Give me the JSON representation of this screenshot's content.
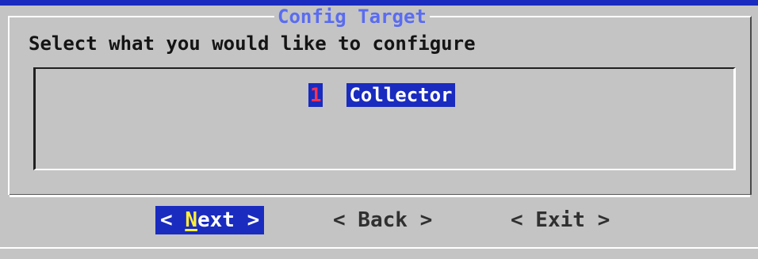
{
  "dialog": {
    "title": "Config Target",
    "prompt": "Select what you would like to configure"
  },
  "menu": {
    "items": [
      {
        "key": "1",
        "label": "Collector"
      }
    ]
  },
  "buttons": {
    "next": {
      "open": "< ",
      "hotkey": "N",
      "rest": "ext",
      "close": " >"
    },
    "back": "< Back >",
    "exit": "< Exit >"
  },
  "colors": {
    "background": "#c4c4c4",
    "selection": "#1a2bbf",
    "title": "#5a6cf0",
    "hotkey": "#ffef3a",
    "menu_key": "#ff3050"
  }
}
